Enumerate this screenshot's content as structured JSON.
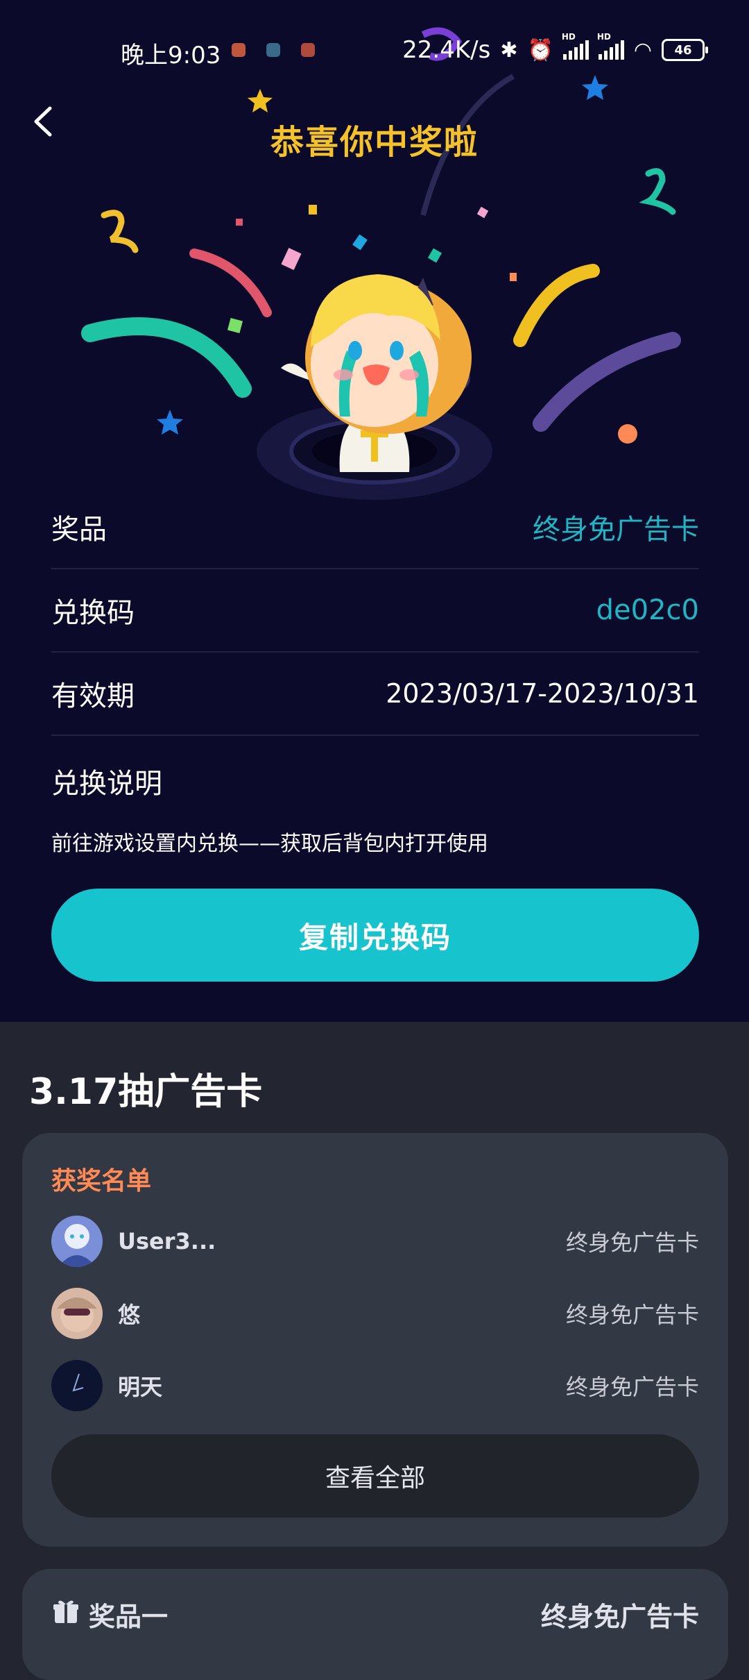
{
  "status_bar": {
    "time": "晚上9:03",
    "network_speed": "22.4K/s",
    "battery": "46",
    "signal_badge": "HD"
  },
  "header": {
    "title": "恭喜你中奖啦"
  },
  "prize_info": {
    "prize_label": "奖品",
    "prize_value": "终身免广告卡",
    "code_label": "兑换码",
    "code_value": "de02c0",
    "validity_label": "有效期",
    "validity_value": "2023/03/17-2023/10/31",
    "instructions_label": "兑换说明",
    "instructions_text": "前往游戏设置内兑换——获取后背包内打开使用"
  },
  "copy_button_label": "复制兑换码",
  "event": {
    "title": "3.17抽广告卡",
    "winners_label": "获奖名单",
    "winners": [
      {
        "name": "User3...",
        "prize": "终身免广告卡"
      },
      {
        "name": "悠",
        "prize": "终身免广告卡"
      },
      {
        "name": "明天",
        "prize": "终身免广告卡"
      }
    ],
    "view_all_label": "查看全部"
  },
  "prize_card": {
    "title": "奖品一",
    "prize": "终身免广告卡"
  },
  "colors": {
    "accent": "#17c3cd",
    "title_gold": "#f6c22a",
    "winners_label": "#ff8a55",
    "top_background": "#0b0a2a"
  }
}
